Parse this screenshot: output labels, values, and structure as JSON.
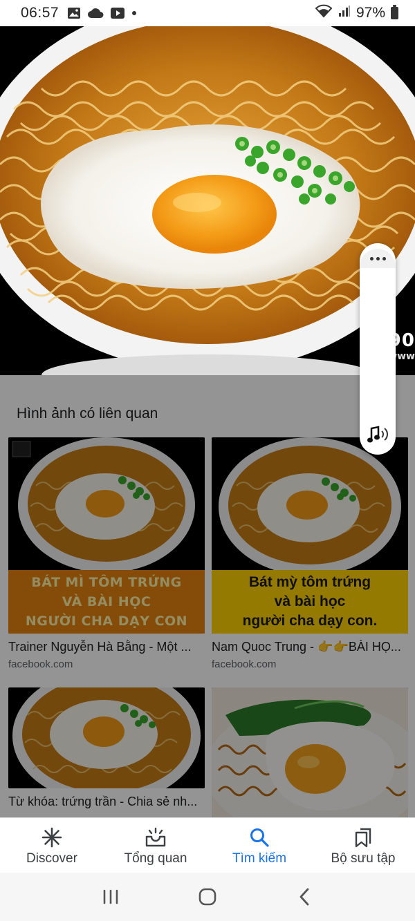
{
  "status_bar": {
    "time": "06:57",
    "battery": "97%",
    "icons": [
      "gallery-icon",
      "cloud-icon",
      "youtube-icon",
      "dot-icon",
      "wifi-icon",
      "signal-icon",
      "battery-icon"
    ]
  },
  "hero": {
    "watermark": "090",
    "watermark2": "www"
  },
  "related": {
    "section_title": "Hình ảnh có liên quan",
    "cards": [
      {
        "title": "Trainer Nguyễn Hà Bằng - Một ...",
        "source": "facebook.com",
        "banner": [
          "BÁT MÌ TÔM TRỨNG",
          "VÀ BÀI HỌC",
          "NGƯỜI CHA DẠY CON"
        ]
      },
      {
        "title": "Nam Quoc Trung - 👉👉BÀI HỌ...",
        "source": "facebook.com",
        "banner": [
          "Bát mỳ tôm trứng",
          "và bài học",
          "người cha dạy con."
        ]
      },
      {
        "title": "Từ khóa: trứng trần - Chia sẻ nh...",
        "source": ""
      },
      {
        "title": "",
        "source": ""
      }
    ]
  },
  "bottom_nav": {
    "items": [
      {
        "label": "Discover",
        "icon": "discover-asterisk-icon"
      },
      {
        "label": "Tổng quan",
        "icon": "updates-tray-icon"
      },
      {
        "label": "Tìm kiếm",
        "icon": "search-icon",
        "active": true
      },
      {
        "label": "Bộ sưu tập",
        "icon": "collections-bookmark-icon"
      }
    ],
    "active_color": "#1a73e8"
  },
  "system_nav": {
    "icons": [
      "recent-apps-icon",
      "home-icon",
      "back-icon"
    ]
  }
}
